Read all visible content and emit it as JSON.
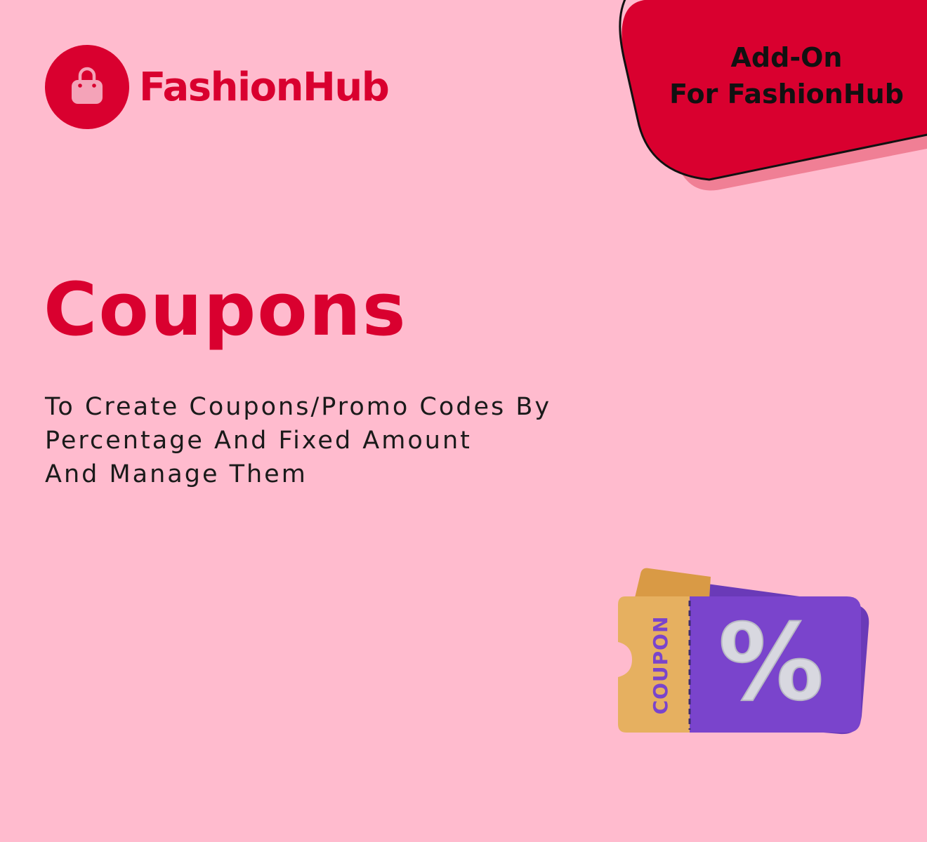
{
  "brand": {
    "name": "FashionHub",
    "color": "#d9002f"
  },
  "badge": {
    "line1": "Add-On",
    "line2": "For FashionHub",
    "color": "#d9002f",
    "shadow_color": "#f07f95"
  },
  "headline": {
    "title": "Coupons"
  },
  "description": {
    "line1": "To Create Coupons/Promo Codes By",
    "line2": "Percentage And Fixed Amount",
    "line3": "And Manage Them"
  },
  "illustration": {
    "stub_label": "COUPON",
    "symbol": "%",
    "stub_color": "#e6b060",
    "ticket_color": "#7a44cc"
  },
  "background_color": "#ffbbce"
}
